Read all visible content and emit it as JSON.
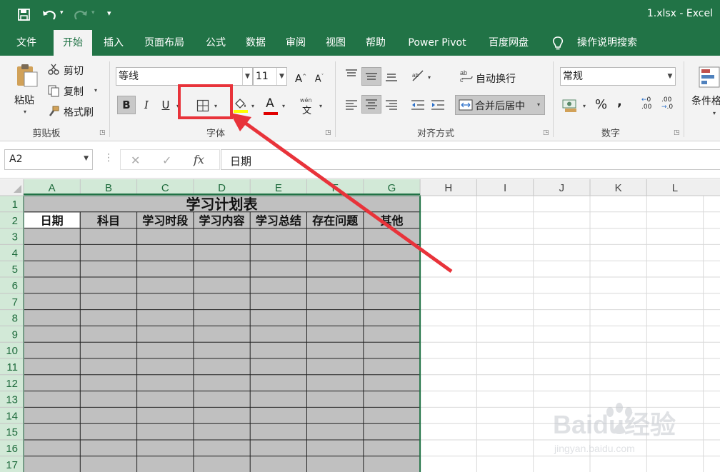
{
  "window": {
    "title": "1.xlsx - Excel"
  },
  "quick_access": {
    "save_icon": "save-icon",
    "undo_icon": "undo-icon",
    "redo_icon": "redo-icon",
    "customize": "▾"
  },
  "tabs": [
    "文件",
    "开始",
    "插入",
    "页面布局",
    "公式",
    "数据",
    "审阅",
    "视图",
    "帮助",
    "Power Pivot",
    "百度网盘"
  ],
  "tell_me": "操作说明搜索",
  "clipboard": {
    "paste": "粘贴",
    "cut": "剪切",
    "copy": "复制",
    "format_painter": "格式刷",
    "group": "剪贴板"
  },
  "font": {
    "name": "等线",
    "size": "11",
    "bold": "B",
    "italic": "I",
    "underline": "U",
    "grow": "A",
    "shrink": "A",
    "font_color": "A",
    "phonetic_top": "wén",
    "phonetic": "文",
    "group": "字体"
  },
  "alignment": {
    "wrap": "自动换行",
    "merge": "合并后居中",
    "group": "对齐方式"
  },
  "number": {
    "format": "常规",
    "percent": "%",
    "comma": ",",
    "inc_dec": ".00",
    "dec_dec": ".0",
    "group": "数字"
  },
  "styles": {
    "conditional": "条件格"
  },
  "formula_bar": {
    "name_box": "A2",
    "cancel": "✕",
    "enter": "✓",
    "fx": "fx",
    "content": "日期"
  },
  "sheet": {
    "columns": [
      "A",
      "B",
      "C",
      "D",
      "E",
      "F",
      "G",
      "H",
      "I",
      "J",
      "K",
      "L"
    ],
    "rows": [
      "1",
      "2",
      "3",
      "4",
      "5",
      "6",
      "7",
      "8",
      "9",
      "10",
      "11",
      "12",
      "13",
      "14",
      "15",
      "16",
      "17"
    ],
    "title": "学习计划表",
    "headers": [
      "日期",
      "科目",
      "学习时段",
      "学习内容",
      "学习总结",
      "存在问题",
      "其他"
    ]
  },
  "colors": {
    "excel_green": "#217346",
    "table_fill": "#c0c0c0",
    "annotation": "#e8333a",
    "selected_header": "#d2e9d7"
  },
  "watermark": {
    "brand": "Baidu经验",
    "url": "jingyan.baidu.com"
  }
}
